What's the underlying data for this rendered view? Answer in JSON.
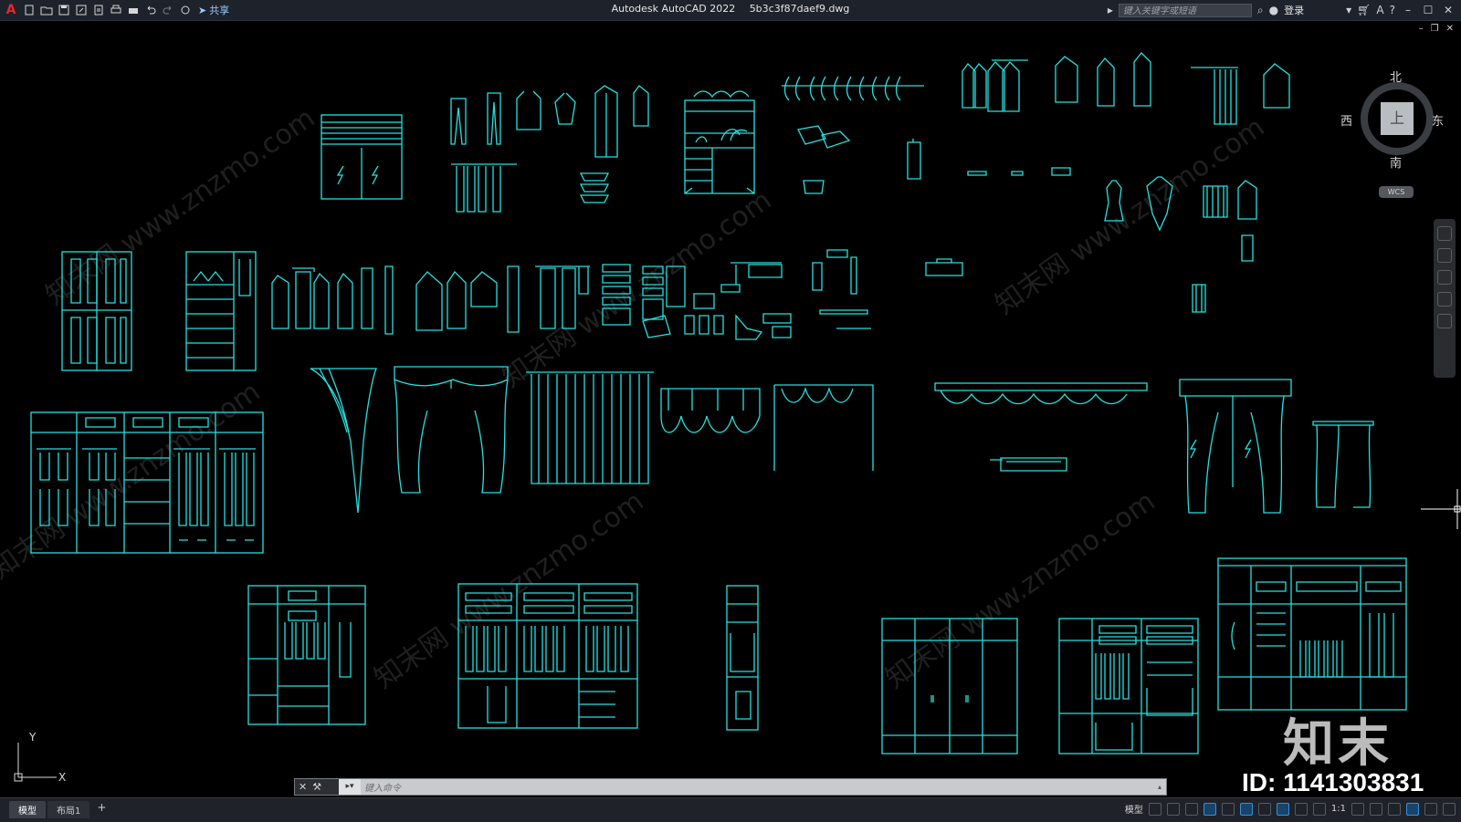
{
  "titlebar": {
    "app": "Autodesk AutoCAD 2022",
    "file": "5b3c3f87daef9.dwg",
    "share_label": "共享",
    "search_placeholder": "键入关键字或短语",
    "login_label": "登录"
  },
  "viewcube": {
    "north": "北",
    "south": "南",
    "east": "东",
    "west": "西",
    "face": "上",
    "wcs_label": "WCS"
  },
  "ucs": {
    "x_label": "X",
    "y_label": "Y"
  },
  "command_line": {
    "placeholder": "键入命令"
  },
  "status": {
    "tabs": [
      "模型",
      "布局1"
    ],
    "model_label": "模型",
    "scale_label": "1:1"
  },
  "watermarks": [
    "知末网 www.znzmo.com"
  ],
  "overlay": {
    "brand": "知末",
    "id_text": "ID: 1141303831"
  },
  "colors": {
    "drawing_line": "#27e0e0",
    "background": "#000000",
    "titlebar": "#1e222a"
  }
}
